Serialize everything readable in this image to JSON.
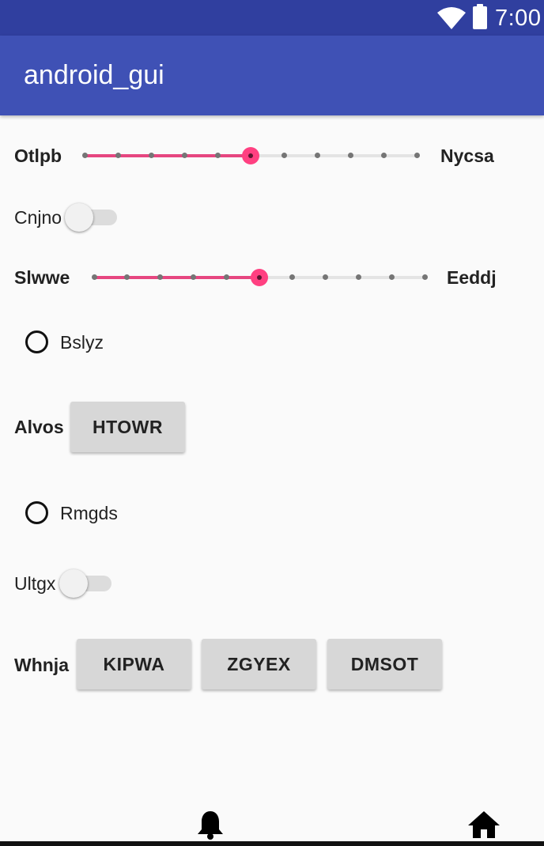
{
  "status_bar": {
    "time": "7:00",
    "icons": [
      "wifi-icon",
      "battery-icon"
    ]
  },
  "app_bar": {
    "title": "android_gui"
  },
  "rows": {
    "seekbar1": {
      "left_label": "Otlpb",
      "right_label": "Nycsa",
      "value": 5,
      "max": 10
    },
    "switch1": {
      "label": "Cnjno",
      "checked": false
    },
    "seekbar2": {
      "left_label": "Slwwe",
      "right_label": "Eeddj",
      "value": 5,
      "max": 10
    },
    "radio1": {
      "label": "Bslyz",
      "checked": false
    },
    "button_row1": {
      "label": "Alvos",
      "buttons": [
        "HTOWR"
      ]
    },
    "radio2": {
      "label": "Rmgds",
      "checked": false
    },
    "switch2": {
      "label": "Ultgx",
      "checked": false
    },
    "button_row2": {
      "label": "Whnja",
      "buttons": [
        "KIPWA",
        "ZGYEX",
        "DMSOT"
      ]
    }
  },
  "bottom_nav": {
    "icons": [
      "bell-icon",
      "home-icon"
    ]
  },
  "colors": {
    "status_bar": "#303f9f",
    "app_bar": "#3f51b5",
    "accent": "#ff4081",
    "background": "#fafafa",
    "button": "#d7d7d7"
  }
}
